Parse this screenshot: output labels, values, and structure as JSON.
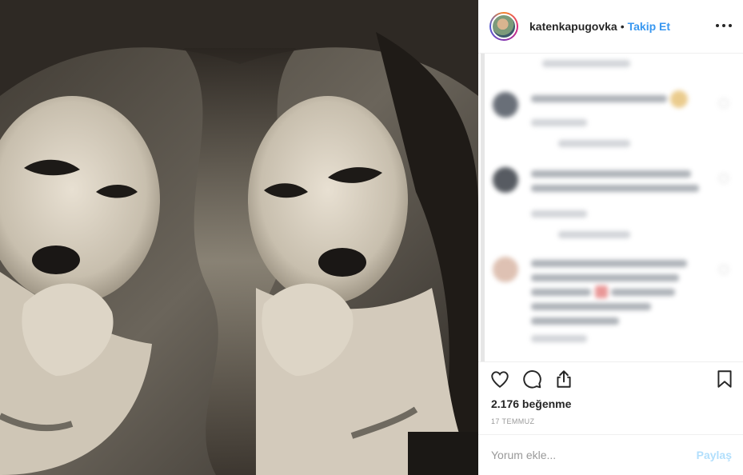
{
  "post": {
    "username": "katenkapugovka",
    "separator": "•",
    "follow_label": "Takip Et",
    "more_icon": "more-options-icon",
    "likes_text": "2.176 beğenme",
    "date_text": "17 TEMMUZ",
    "photo_description_icon": "photo"
  },
  "actions": {
    "like_icon": "heart-icon",
    "comment_icon": "comment-icon",
    "share_icon": "share-icon",
    "save_icon": "bookmark-icon"
  },
  "comment_box": {
    "placeholder": "Yorum ekle...",
    "post_label": "Paylaş"
  },
  "colors": {
    "accent": "#3897f0",
    "post_disabled": "#b2dffc",
    "text": "#262626",
    "muted": "#999999"
  }
}
